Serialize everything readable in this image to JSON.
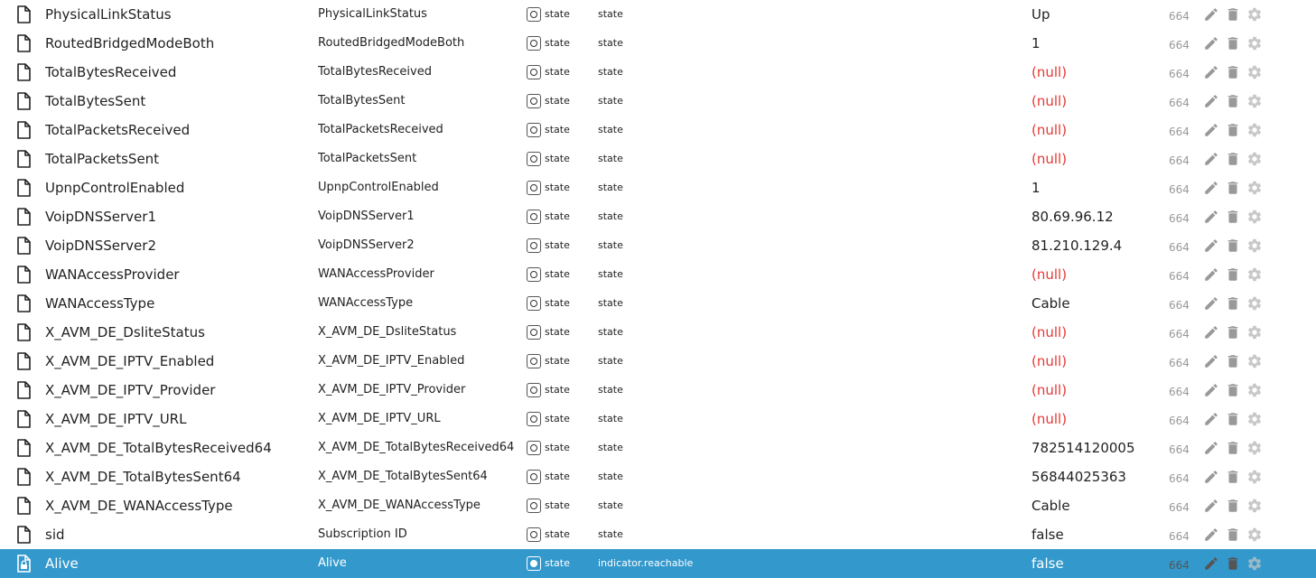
{
  "type_label": "state",
  "rows": [
    {
      "id": "PhysicalLinkStatus",
      "name": "PhysicalLinkStatus",
      "type": "state",
      "role": "state",
      "value": "Up",
      "value_null": false,
      "acl": "664",
      "selected": false
    },
    {
      "id": "RoutedBridgedModeBoth",
      "name": "RoutedBridgedModeBoth",
      "type": "state",
      "role": "state",
      "value": "1",
      "value_null": false,
      "acl": "664",
      "selected": false
    },
    {
      "id": "TotalBytesReceived",
      "name": "TotalBytesReceived",
      "type": "state",
      "role": "state",
      "value": "(null)",
      "value_null": true,
      "acl": "664",
      "selected": false
    },
    {
      "id": "TotalBytesSent",
      "name": "TotalBytesSent",
      "type": "state",
      "role": "state",
      "value": "(null)",
      "value_null": true,
      "acl": "664",
      "selected": false
    },
    {
      "id": "TotalPacketsReceived",
      "name": "TotalPacketsReceived",
      "type": "state",
      "role": "state",
      "value": "(null)",
      "value_null": true,
      "acl": "664",
      "selected": false
    },
    {
      "id": "TotalPacketsSent",
      "name": "TotalPacketsSent",
      "type": "state",
      "role": "state",
      "value": "(null)",
      "value_null": true,
      "acl": "664",
      "selected": false
    },
    {
      "id": "UpnpControlEnabled",
      "name": "UpnpControlEnabled",
      "type": "state",
      "role": "state",
      "value": "1",
      "value_null": false,
      "acl": "664",
      "selected": false
    },
    {
      "id": "VoipDNSServer1",
      "name": "VoipDNSServer1",
      "type": "state",
      "role": "state",
      "value": "80.69.96.12",
      "value_null": false,
      "acl": "664",
      "selected": false
    },
    {
      "id": "VoipDNSServer2",
      "name": "VoipDNSServer2",
      "type": "state",
      "role": "state",
      "value": "81.210.129.4",
      "value_null": false,
      "acl": "664",
      "selected": false
    },
    {
      "id": "WANAccessProvider",
      "name": "WANAccessProvider",
      "type": "state",
      "role": "state",
      "value": "(null)",
      "value_null": true,
      "acl": "664",
      "selected": false
    },
    {
      "id": "WANAccessType",
      "name": "WANAccessType",
      "type": "state",
      "role": "state",
      "value": "Cable",
      "value_null": false,
      "acl": "664",
      "selected": false
    },
    {
      "id": "X_AVM_DE_DsliteStatus",
      "name": "X_AVM_DE_DsliteStatus",
      "type": "state",
      "role": "state",
      "value": "(null)",
      "value_null": true,
      "acl": "664",
      "selected": false
    },
    {
      "id": "X_AVM_DE_IPTV_Enabled",
      "name": "X_AVM_DE_IPTV_Enabled",
      "type": "state",
      "role": "state",
      "value": "(null)",
      "value_null": true,
      "acl": "664",
      "selected": false
    },
    {
      "id": "X_AVM_DE_IPTV_Provider",
      "name": "X_AVM_DE_IPTV_Provider",
      "type": "state",
      "role": "state",
      "value": "(null)",
      "value_null": true,
      "acl": "664",
      "selected": false
    },
    {
      "id": "X_AVM_DE_IPTV_URL",
      "name": "X_AVM_DE_IPTV_URL",
      "type": "state",
      "role": "state",
      "value": "(null)",
      "value_null": true,
      "acl": "664",
      "selected": false
    },
    {
      "id": "X_AVM_DE_TotalBytesReceived64",
      "name": "X_AVM_DE_TotalBytesReceived64",
      "type": "state",
      "role": "state",
      "value": "782514120005",
      "value_null": false,
      "acl": "664",
      "selected": false
    },
    {
      "id": "X_AVM_DE_TotalBytesSent64",
      "name": "X_AVM_DE_TotalBytesSent64",
      "type": "state",
      "role": "state",
      "value": "56844025363",
      "value_null": false,
      "acl": "664",
      "selected": false
    },
    {
      "id": "X_AVM_DE_WANAccessType",
      "name": "X_AVM_DE_WANAccessType",
      "type": "state",
      "role": "state",
      "value": "Cable",
      "value_null": false,
      "acl": "664",
      "selected": false
    },
    {
      "id": "sid",
      "name": "Subscription ID",
      "type": "state",
      "role": "state",
      "value": "false",
      "value_null": false,
      "acl": "664",
      "selected": false
    },
    {
      "id": "Alive",
      "name": "Alive",
      "type": "state",
      "role": "indicator.reachable",
      "value": "false",
      "value_null": false,
      "acl": "664",
      "selected": true
    }
  ],
  "icons": {
    "row": "file-icon",
    "row_selected": "file-lock-icon",
    "type": "state-icon",
    "edit": "pencil-icon",
    "delete": "trash-icon",
    "config": "gear-icon"
  },
  "colors": {
    "selected_bg": "#3399cc",
    "null_value": "#e53935",
    "action_icon": "#999999"
  }
}
